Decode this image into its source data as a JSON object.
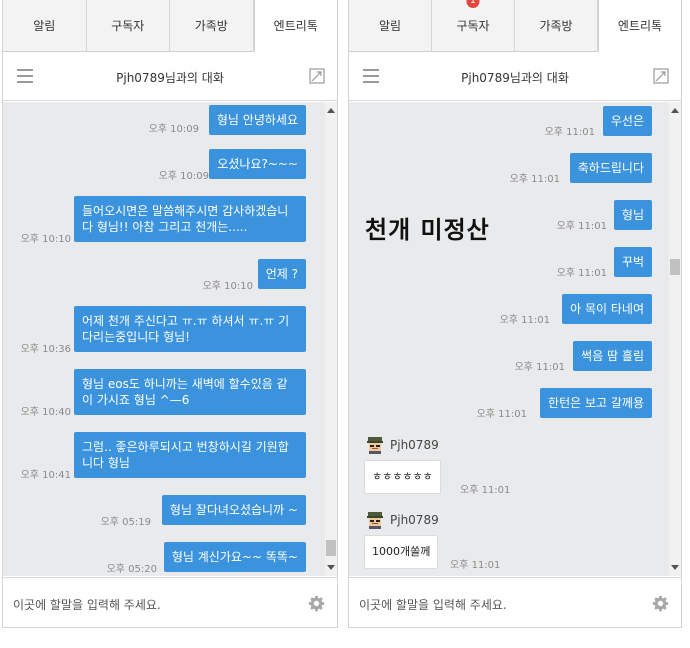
{
  "left": {
    "tabs": [
      {
        "label": "알림"
      },
      {
        "label": "구독자"
      },
      {
        "label": "가족방"
      },
      {
        "label": "엔트리톡"
      }
    ],
    "header": {
      "title": "Pjh0789님과의 대화"
    },
    "messages": [
      {
        "text": "형님 안녕하세요",
        "time": "오후 10:09"
      },
      {
        "text": "오셨나요?~~~",
        "time": "오후 10:09"
      },
      {
        "text": "들어오시면은 말씀해주시면 감사하겠습니다 형님!! 아참 그리고 천개는.....",
        "time": "오후 10:10"
      },
      {
        "text": "언제 ?",
        "time": "오후 10:10"
      },
      {
        "text": "어제 천개 주신다고 ㅠ.ㅠ 하셔서 ㅠ.ㅠ 기다리는중입니다 형님!",
        "time": "오후 10:36"
      },
      {
        "text": "형님 eos도 하니까는 새벽에 할수있음 같이 가시죠 형님 ^—6",
        "time": "오후 10:40"
      },
      {
        "text": "그럼.. 좋은하루되시고 번창하시길 기원합니다 형님",
        "time": "오후 10:41"
      },
      {
        "text": "형님 잘다녀오셨습니까 ~",
        "time": "오후 05:19"
      },
      {
        "text": "형님 계신가요~~ 똑똑~",
        "time": "오후 05:20"
      }
    ],
    "input_placeholder": "이곳에 할말을 입력해 주세요."
  },
  "right": {
    "tabs": [
      {
        "label": "알림"
      },
      {
        "label": "구독자",
        "badge": "1"
      },
      {
        "label": "가족방"
      },
      {
        "label": "엔트리톡"
      }
    ],
    "header": {
      "title": "Pjh0789님과의 대화"
    },
    "overlay_text": "천개 미정산",
    "messages": [
      {
        "text": "우선은",
        "time": "오후 11:01"
      },
      {
        "text": "축하드립니다",
        "time": "오후 11:01"
      },
      {
        "text": "형님",
        "time": "오후 11:01"
      },
      {
        "text": "꾸벅",
        "time": "오후 11:01"
      },
      {
        "text": "아 목이 타네여",
        "time": "오후 11:01"
      },
      {
        "text": "썩음 땀 흘림",
        "time": "오후 11:01"
      },
      {
        "text": "한턴은 보고 갈께용",
        "time": "오후 11:01"
      }
    ],
    "incoming": [
      {
        "sender": "Pjh0789",
        "text": "ㅎㅎㅎㅎㅎㅎ",
        "time": "오후 11:01"
      },
      {
        "sender": "Pjh0789",
        "text": "1000개쏠께",
        "time": "오후 11:01"
      }
    ],
    "input_placeholder": "이곳에 할말을 입력해 주세요."
  },
  "colors": {
    "bubble": "#3a93dc",
    "chat_bg": "#e9eaec",
    "badge": "#e2463c"
  },
  "icons": [
    "menu-icon",
    "popout-icon",
    "gear-icon",
    "avatar-icon",
    "scroll-up-icon",
    "scroll-down-icon"
  ]
}
